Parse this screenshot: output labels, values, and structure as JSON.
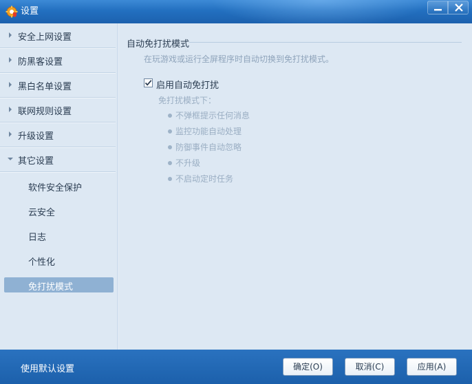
{
  "window": {
    "title": "设置",
    "icon": "gear-shield-icon",
    "accent_color": "#1d63ae"
  },
  "sidebar": {
    "items": [
      {
        "label": "安全上网设置",
        "icon": "chevron-right-icon",
        "expanded": false
      },
      {
        "label": "防黑客设置",
        "icon": "chevron-right-icon",
        "expanded": false
      },
      {
        "label": "黑白名单设置",
        "icon": "chevron-right-icon",
        "expanded": false
      },
      {
        "label": "联网规则设置",
        "icon": "chevron-right-icon",
        "expanded": false
      },
      {
        "label": "升级设置",
        "icon": "chevron-right-icon",
        "expanded": false
      },
      {
        "label": "其它设置",
        "icon": "chevron-down-icon",
        "expanded": true
      }
    ],
    "sub_items": [
      {
        "label": "软件安全保护",
        "active": false
      },
      {
        "label": "云安全",
        "active": false
      },
      {
        "label": "日志",
        "active": false
      },
      {
        "label": "个性化",
        "active": false
      },
      {
        "label": "免打扰模式",
        "active": true
      }
    ]
  },
  "main": {
    "section_title": "自动免打扰模式",
    "description": "在玩游戏或运行全屏程序时自动切换到免打扰模式。",
    "enable_checkbox": {
      "label": "启用自动免打扰",
      "checked": true
    },
    "mode_label": "免打扰模式下：",
    "bullets": [
      "不弹框提示任何消息",
      "监控功能自动处理",
      "防御事件自动忽略",
      "不升级",
      "不启动定时任务"
    ]
  },
  "footer": {
    "default_link": "使用默认设置",
    "ok_label": "确定(O)",
    "cancel_label": "取消(C)",
    "apply_label": "应用(A)"
  }
}
